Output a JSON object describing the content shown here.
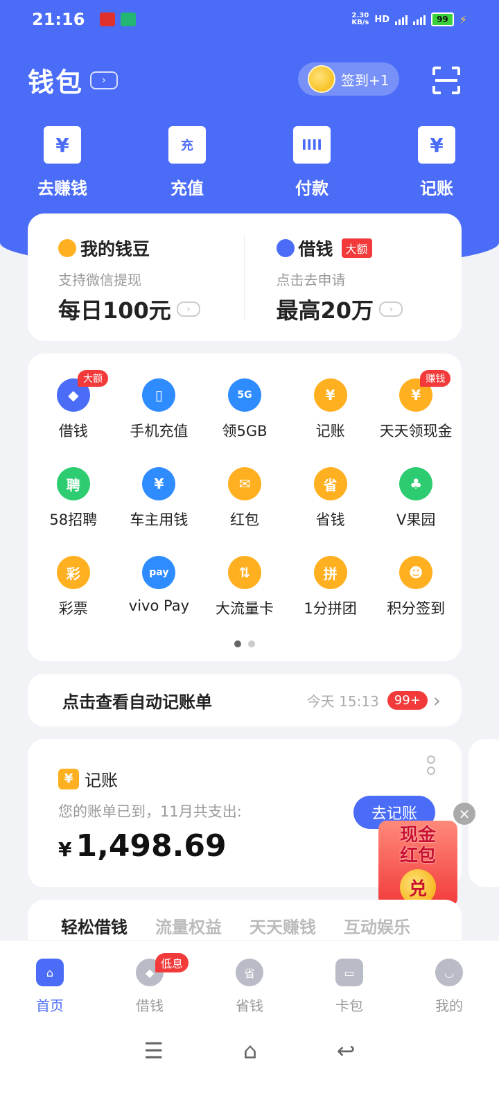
{
  "status_bar": {
    "time": "21:16",
    "net_speed_value": "2.30",
    "net_speed_unit": "KB/s",
    "battery": "99"
  },
  "header": {
    "title": "钱包",
    "signin_label": "签到+1"
  },
  "top_actions": [
    {
      "label": "去赚钱",
      "icon": "¥"
    },
    {
      "label": "充值",
      "icon": "充"
    },
    {
      "label": "付款",
      "icon": "IIII"
    },
    {
      "label": "记账",
      "icon": "¥"
    }
  ],
  "beans": {
    "left": {
      "title": "我的钱豆",
      "sub": "支持微信提现",
      "main": "每日100元"
    },
    "right": {
      "title": "借钱",
      "tag": "大额",
      "sub": "点击去申请",
      "main": "最高20万"
    }
  },
  "grid": [
    {
      "label": "借钱",
      "badge": "大额",
      "color": "#4a6cf7",
      "glyph": "◆"
    },
    {
      "label": "手机充值",
      "badge": "",
      "color": "#2f8cff",
      "glyph": "▯"
    },
    {
      "label": "领5GB",
      "badge": "",
      "color": "#2f8cff",
      "glyph": "5G"
    },
    {
      "label": "记账",
      "badge": "",
      "color": "#ffb020",
      "glyph": "¥"
    },
    {
      "label": "天天领现金",
      "badge": "赚钱",
      "color": "#ffb020",
      "glyph": "¥"
    },
    {
      "label": "58招聘",
      "badge": "",
      "color": "#2ecc71",
      "glyph": "聘"
    },
    {
      "label": "车主用钱",
      "badge": "",
      "color": "#2f8cff",
      "glyph": "¥"
    },
    {
      "label": "红包",
      "badge": "",
      "color": "#ffb020",
      "glyph": "✉"
    },
    {
      "label": "省钱",
      "badge": "",
      "color": "#ffb020",
      "glyph": "省"
    },
    {
      "label": "V果园",
      "badge": "",
      "color": "#2ecc71",
      "glyph": "♣"
    },
    {
      "label": "彩票",
      "badge": "",
      "color": "#ffb020",
      "glyph": "彩"
    },
    {
      "label": "vivo Pay",
      "badge": "",
      "color": "#2f8cff",
      "glyph": "pay"
    },
    {
      "label": "大流量卡",
      "badge": "",
      "color": "#ffb020",
      "glyph": "⇅"
    },
    {
      "label": "1分拼团",
      "badge": "",
      "color": "#ffb020",
      "glyph": "拼"
    },
    {
      "label": "积分签到",
      "badge": "",
      "color": "#ffb020",
      "glyph": "☻"
    }
  ],
  "auto_bill": {
    "text": "点击查看自动记账单",
    "time": "今天 15:13",
    "count": "99+"
  },
  "bill": {
    "title": "记账",
    "sub": "您的账单已到，11月共支出:",
    "currency": "¥",
    "amount": "1,498.69",
    "button": "去记账"
  },
  "redpack": {
    "line1": "现金",
    "line2": "红包",
    "coin": "兑"
  },
  "tabs": [
    "轻松借钱",
    "流量权益",
    "天天赚钱",
    "互动娱乐"
  ],
  "bottom_nav": [
    {
      "label": "首页",
      "badge": ""
    },
    {
      "label": "借钱",
      "badge": "低息"
    },
    {
      "label": "省钱",
      "badge": ""
    },
    {
      "label": "卡包",
      "badge": ""
    },
    {
      "label": "我的",
      "badge": ""
    }
  ],
  "colors": {
    "primary": "#4a6cf7",
    "badge_red": "#f23a3a",
    "accent_orange": "#ffb020"
  }
}
